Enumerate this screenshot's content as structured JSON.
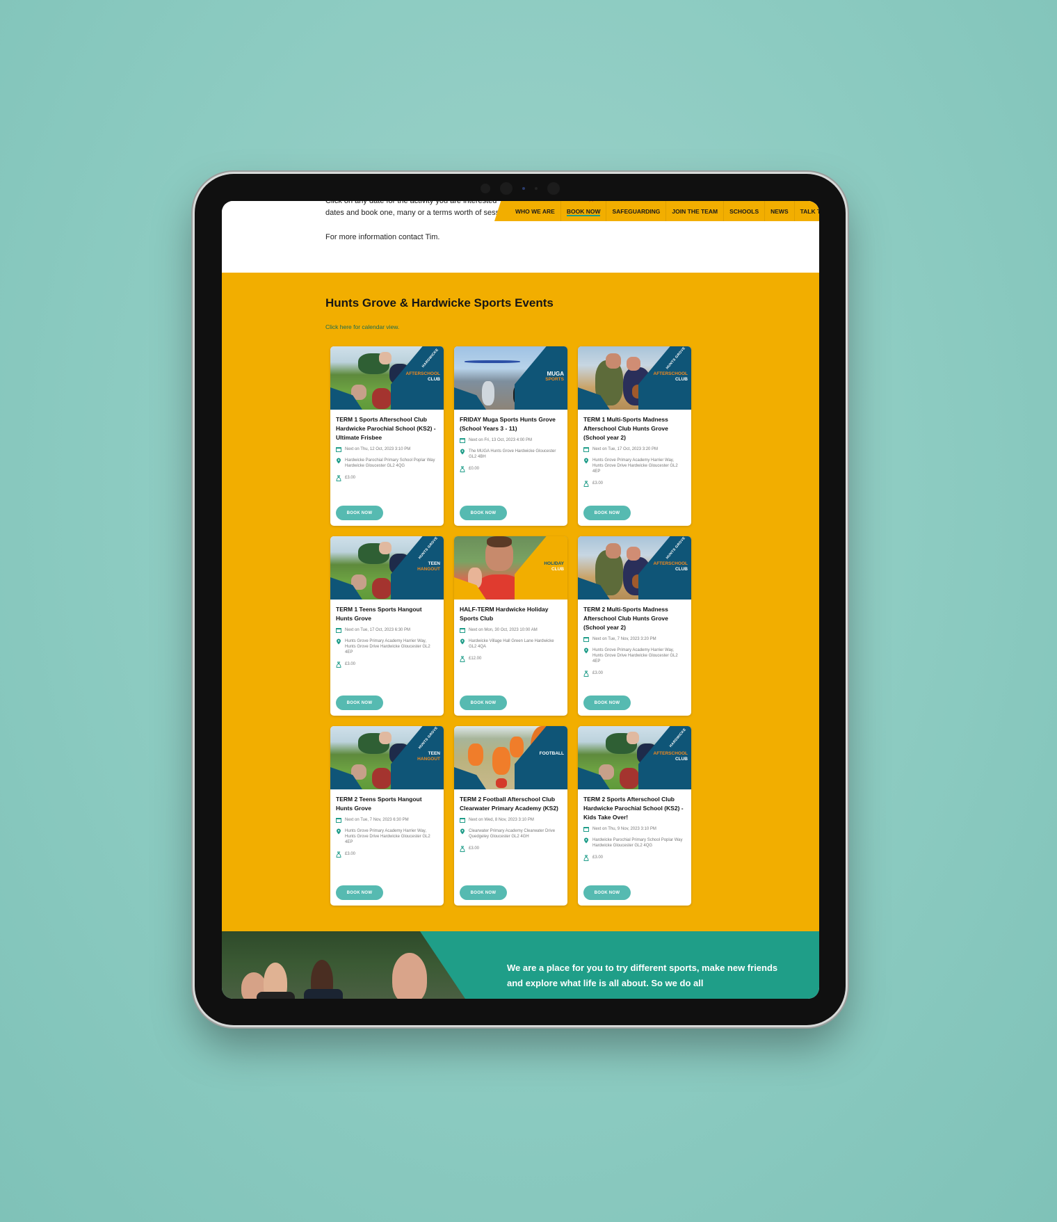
{
  "intro": {
    "line1": "Click on any date for the activity you are interested",
    "line2": "dates and book one, many or a terms worth of sess",
    "line3": "For more information contact Tim."
  },
  "nav": {
    "items": [
      {
        "label": "WHO WE ARE",
        "active": false
      },
      {
        "label": "BOOK NOW",
        "active": true
      },
      {
        "label": "SAFEGUARDING",
        "active": false
      },
      {
        "label": "JOIN THE TEAM",
        "active": false
      },
      {
        "label": "SCHOOLS",
        "active": false
      },
      {
        "label": "NEWS",
        "active": false
      },
      {
        "label": "TALK TO US",
        "active": false
      }
    ]
  },
  "events": {
    "title": "Hunts Grove & Hardwicke Sports Events",
    "calendar_link": "Click here for calendar view.",
    "book_label": "BOOK NOW",
    "cards": [
      {
        "title": "TERM 1 Sports Afterschool Club Hardwicke Parochial School (KS2) - Ultimate Frisbee",
        "date": "Next on Thu, 12 Oct, 2023 3:10 PM",
        "location": "Hardwicke Parochial Primary School Poplar Way Hardwicke Gloucester GL2 4QG",
        "price": "£3.00",
        "badge": {
          "diag": "HARDWICKE",
          "accent": "AFTERSCHOOL",
          "main": "CLUB",
          "bg": "#0f5577"
        },
        "photo": "pyramid"
      },
      {
        "title": "FRIDAY Muga Sports Hunts Grove (School Years 3 - 11)",
        "date": "Next on Fri, 13 Oct, 2023 4:00 PM",
        "location": "The MUGA Hunts Grove Hardwicke Gloucester GL2 4BH",
        "price": "£0.00",
        "badge": {
          "diag": "",
          "accent": "",
          "main": "MUGA",
          "sub": "SPORTS",
          "bg": "#0f5577"
        },
        "photo": "muga"
      },
      {
        "title": "TERM 1 Multi-Sports Madness Afterschool Club Hunts Grove (School year 2)",
        "date": "Next on Tue, 17 Oct, 2023 3:20 PM",
        "location": "Hunts Grove Primary Academy Harrier Way, Hunts Grove Drive Hardwicke Gloucester GL2 4EP",
        "price": "£3.00",
        "badge": {
          "diag": "HUNTS GROVE",
          "accent": "AFTERSCHOOL",
          "main": "CLUB",
          "bg": "#0f5577"
        },
        "photo": "girls"
      },
      {
        "title": "TERM 1 Teens Sports Hangout Hunts Grove",
        "date": "Next on Tue, 17 Oct, 2023 6:30 PM",
        "location": "Hunts Grove Primary Academy Harrier Way, Hunts Grove Drive Hardwicke Gloucester GL2 4EP",
        "price": "£3.00",
        "badge": {
          "diag": "HUNTS GROVE",
          "accent": "",
          "main": "TEEN",
          "sub": "HANGOUT",
          "bg": "#0f5577"
        },
        "photo": "pyramid"
      },
      {
        "title": "HALF-TERM Hardwicke Holiday Sports Club",
        "date": "Next on Mon, 30 Oct, 2023 10:00 AM",
        "location": "Hardwicke Village Hall Green Lane Hardwicke GL2 4QA",
        "price": "£12.00",
        "badge": {
          "diag": "",
          "accent": "",
          "main": "HOLIDAY",
          "sub2": "CLUB",
          "bg": "#f2ae00"
        },
        "photo": "thumbs"
      },
      {
        "title": "TERM 2 Multi-Sports Madness Afterschool Club Hunts Grove (School year 2)",
        "date": "Next on Tue, 7 Nov, 2023 3:20 PM",
        "location": "Hunts Grove Primary Academy Harrier Way, Hunts Grove Drive Hardwicke Gloucester GL2 4EP",
        "price": "£3.00",
        "badge": {
          "diag": "HUNTS GROVE",
          "accent": "AFTERSCHOOL",
          "main": "CLUB",
          "bg": "#0f5577"
        },
        "photo": "girls"
      },
      {
        "title": "TERM 2 Teens Sports Hangout Hunts Grove",
        "date": "Next on Tue, 7 Nov, 2023 6:30 PM",
        "location": "Hunts Grove Primary Academy Harrier Way, Hunts Grove Drive Hardwicke Gloucester GL2 4EP",
        "price": "£3.00",
        "badge": {
          "diag": "HUNTS GROVE",
          "accent": "",
          "main": "TEEN",
          "sub": "HANGOUT",
          "bg": "#0f5577"
        },
        "photo": "pyramid"
      },
      {
        "title": "TERM 2 Football Afterschool Club Clearwater Primary Academy (KS2)",
        "date": "Next on Wed, 8 Nov, 2023 3:10 PM",
        "location": "Clearwater Primary Academy Clearwater Drive Quedgeley Gloucester GL2 4GH",
        "price": "£3.00",
        "badge": {
          "diag": "",
          "accent": "",
          "main": "FOOTBALL",
          "bg": "#0f5577"
        },
        "photo": "football"
      },
      {
        "title": "TERM 2 Sports Afterschool Club Hardwicke Parochial School (KS2) - Kids Take Over!",
        "date": "Next on Thu, 9 Nov, 2023 3:10 PM",
        "location": "Hardwicke Parochial Primary School Poplar Way Hardwicke Gloucester GL2 4QG",
        "price": "£3.00",
        "badge": {
          "diag": "HARDWICKE",
          "accent": "AFTERSCHOOL",
          "main": "CLUB",
          "bg": "#0f5577"
        },
        "photo": "pyramid"
      }
    ]
  },
  "hero": {
    "text": "We are a place for you to try different sports, make new friends and explore what life is all about. So we do all"
  },
  "colors": {
    "brand_yellow": "#f2ae00",
    "teal": "#1f9e88",
    "button_teal": "#56bab1",
    "navy": "#0f5577"
  },
  "icons": {
    "date": "calendar-icon",
    "location": "map-pin-icon",
    "price": "money-bag-icon"
  }
}
